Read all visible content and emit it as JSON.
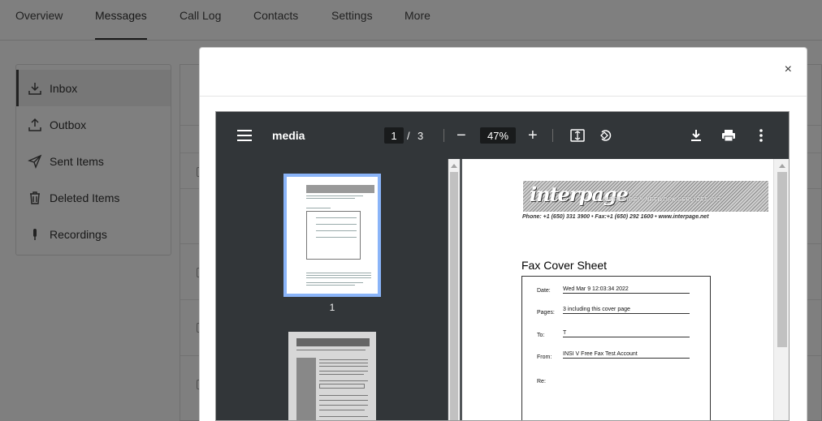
{
  "nav": {
    "tabs": [
      "Overview",
      "Messages",
      "Call Log",
      "Contacts",
      "Settings",
      "More"
    ],
    "active": "Messages"
  },
  "sidebar": {
    "items": [
      {
        "label": "Inbox",
        "icon": "download-tray-icon"
      },
      {
        "label": "Outbox",
        "icon": "upload-tray-icon"
      },
      {
        "label": "Sent Items",
        "icon": "paper-plane-icon"
      },
      {
        "label": "Deleted Items",
        "icon": "trash-icon"
      },
      {
        "label": "Recordings",
        "icon": "microphone-icon"
      }
    ],
    "active": "Inbox"
  },
  "modal": {
    "close_label": "×"
  },
  "viewer": {
    "title": "media",
    "current_page": "1",
    "page_separator": "/",
    "total_pages": "3",
    "zoom": "47%",
    "zoom_out_label": "−",
    "zoom_in_label": "+",
    "thumbnail_number": "1"
  },
  "document": {
    "logo_text": "interpage",
    "logo_subtext": "INTERPAGE™ NETWORK SERVICES INC.",
    "contact_line": "Phone: +1 (650) 331 3900  •  Fax:+1 (650) 292 1600 •  www.interpage.net",
    "heading": "Fax Cover Sheet",
    "fields": [
      {
        "label": "Date:",
        "value": "Wed Mar  9 12:03:34 2022"
      },
      {
        "label": "Pages:",
        "value": "3 including this cover page"
      },
      {
        "label": "To:",
        "value": "T"
      },
      {
        "label": "From:",
        "value": "INSI V Free Fax Test Account"
      },
      {
        "label": "Re:",
        "value": ""
      }
    ]
  },
  "colors": {
    "toolbar_bg": "#323639",
    "viewer_bg": "#525659",
    "thumbnail_highlight": "#8ab4f8"
  }
}
